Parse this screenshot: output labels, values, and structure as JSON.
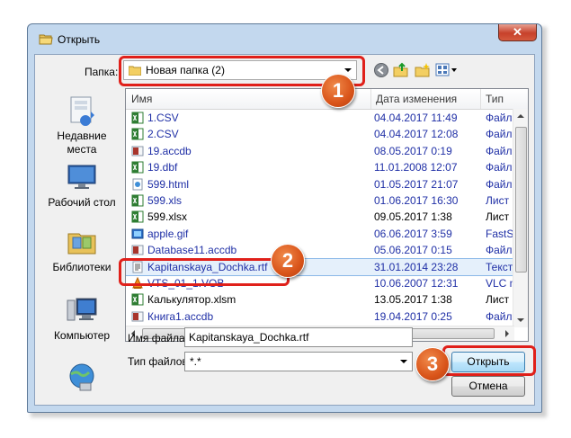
{
  "window": {
    "title": "Открыть",
    "close_label": "✕"
  },
  "toolbar": {
    "folder_label": "Папка:",
    "folder_value": "Новая папка (2)",
    "icons": [
      "back-icon",
      "up-folder-icon",
      "new-folder-icon",
      "view-menu-icon"
    ]
  },
  "places": [
    {
      "label": "Недавние места",
      "icon": "recent-places-icon"
    },
    {
      "label": "Рабочий стол",
      "icon": "desktop-icon"
    },
    {
      "label": "Библиотеки",
      "icon": "libraries-icon"
    },
    {
      "label": "Компьютер",
      "icon": "computer-icon"
    },
    {
      "label": "",
      "icon": "network-icon"
    }
  ],
  "columns": {
    "name": "Имя",
    "date": "Дата изменения",
    "type": "Тип"
  },
  "files": [
    {
      "name": "1.CSV",
      "date": "04.04.2017 11:49",
      "type": "Файл M",
      "icon": "excel-icon"
    },
    {
      "name": "2.CSV",
      "date": "04.04.2017 12:08",
      "type": "Файл M",
      "icon": "excel-icon"
    },
    {
      "name": "19.accdb",
      "date": "08.05.2017 0:19",
      "type": "Файл '",
      "icon": "access-icon"
    },
    {
      "name": "19.dbf",
      "date": "11.01.2008 12:07",
      "type": "Файл '",
      "icon": "excel-icon"
    },
    {
      "name": "599.html",
      "date": "01.05.2017 21:07",
      "type": "Файл '",
      "icon": "html-icon"
    },
    {
      "name": "599.xls",
      "date": "01.06.2017 16:30",
      "type": "Лист M",
      "icon": "excel-icon"
    },
    {
      "name": "599.xlsx",
      "date": "09.05.2017 1:38",
      "type": "Лист M",
      "icon": "excel-icon"
    },
    {
      "name": "apple.gif",
      "date": "06.06.2017 3:59",
      "type": "FastSto",
      "icon": "image-icon"
    },
    {
      "name": "Database11.accdb",
      "date": "05.06.2017 0:15",
      "type": "Файл '",
      "icon": "access-icon"
    },
    {
      "name": "Kapitanskaya_Dochka.rtf",
      "date": "31.01.2014 23:28",
      "type": "Текст I",
      "icon": "rtf-icon"
    },
    {
      "name": "VTS_01_1.VOB",
      "date": "10.06.2007 12:31",
      "type": "VLC m",
      "icon": "vlc-icon"
    },
    {
      "name": "Калькулятор.xlsm",
      "date": "13.05.2017 1:38",
      "type": "Лист M",
      "icon": "excel-icon"
    },
    {
      "name": "Книга1.accdb",
      "date": "19.04.2017 0:25",
      "type": "Файл '",
      "icon": "access-icon"
    }
  ],
  "filename": {
    "label": "Имя файла:",
    "value": "Kapitanskaya_Dochka.rtf"
  },
  "filetype": {
    "label": "Тип файлов:",
    "value": "*.*"
  },
  "buttons": {
    "open": "Открыть",
    "cancel": "Отмена"
  },
  "badges": [
    "1",
    "2",
    "3"
  ],
  "colors": {
    "highlight": "#e0201a",
    "badge": "#d9541a",
    "link_text": "#1f2fa6",
    "selection": "#e5f0fb"
  }
}
